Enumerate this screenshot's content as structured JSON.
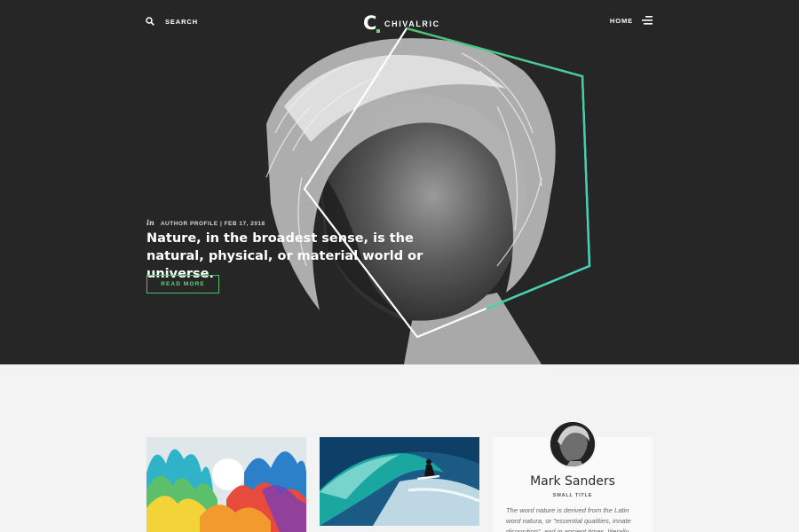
{
  "header": {
    "search_label": "SEARCH",
    "logo_mark": "C",
    "logo_text": "CHIVALRIC",
    "home_label": "HOME"
  },
  "hero": {
    "meta_in": "in",
    "meta": "AUTHOR PROFILE | FEB 17, 2018",
    "title": "Nature, in the broadest sense, is the natural, physical, or material world or universe.",
    "button_label": "READ MORE"
  },
  "author": {
    "name": "Mark Sanders",
    "subtitle": "SMALL TITLE",
    "bio": "The word nature is derived from the Latin word natura, or \"essential qualities, innate disposition\", and in ancient times, literally"
  },
  "icons": {
    "search": "search-icon",
    "menu": "menu-icon"
  },
  "colors": {
    "hero_bg": "#262626",
    "accent_green": "#49c26f",
    "accent_teal": "#3fd6c2",
    "page_bg": "#f3f3f3"
  }
}
